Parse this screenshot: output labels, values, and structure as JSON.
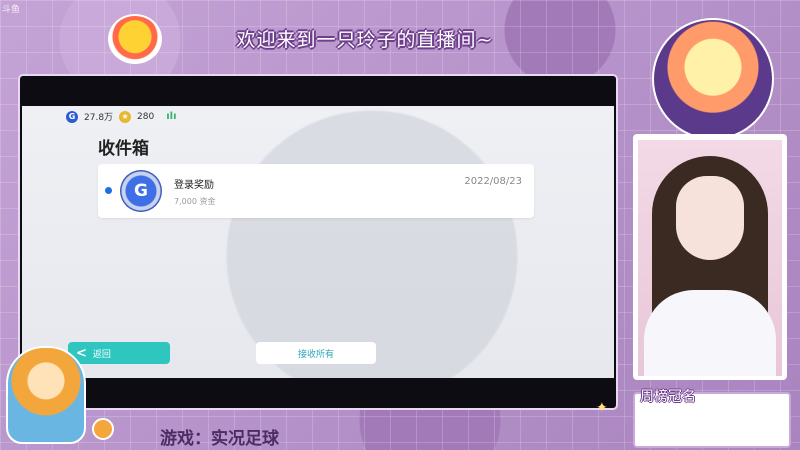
{
  "stream": {
    "corner_logo": "斗鱼",
    "banner_title": "欢迎来到一只玲子的直播间~",
    "name_label": "周榜冠名",
    "game_label": "游戏：实况足球"
  },
  "game_ui": {
    "currency": [
      {
        "icon": "g-coin-icon",
        "value": "27.8万"
      },
      {
        "icon": "star-coin-icon",
        "value": "280"
      }
    ],
    "signal": "ılı",
    "inbox_title": "收件箱",
    "mails": [
      {
        "icon_letter": "G",
        "subject": "登录奖励",
        "amount": "7,000 资金",
        "date": "2022/08/23",
        "unread": true
      }
    ],
    "back_label": "返回",
    "receive_all_label": "接收所有"
  },
  "colors": {
    "accent_teal": "#2fc6c0",
    "unread_blue": "#1f6fe0",
    "frame_purple": "#b793c9"
  }
}
